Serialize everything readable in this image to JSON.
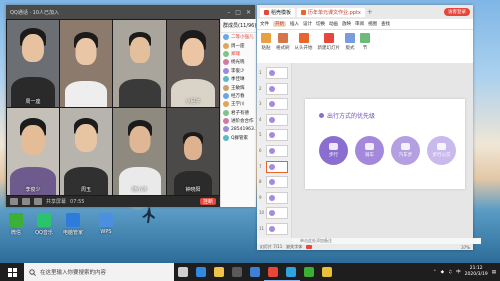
{
  "colors": {
    "accent_red": "#e8463a",
    "wps_orange": "#e8652b",
    "slide_purple": "#6a4fb0",
    "circle_colors": [
      "#8a6fd0",
      "#a388dc",
      "#b49fe3",
      "#c9b9ec"
    ]
  },
  "desktop": {
    "icons": [
      {
        "label": "WPS",
        "icon": "wps-doc-icon"
      },
      {
        "label": "QQ音乐",
        "icon": "music-icon"
      },
      {
        "label": "电脑管家",
        "icon": "shield-icon"
      },
      {
        "label": "微信",
        "icon": "wechat-icon"
      }
    ]
  },
  "qq": {
    "title": "QQ通话 · 10人已加入",
    "participants": [
      "周一座",
      "",
      "",
      "小尼子",
      "李俊少",
      "周玉",
      "随小沐",
      "钟晓阳"
    ],
    "controls": {
      "screen": "共享屏幕",
      "time": "07:55",
      "hangup": "挂断"
    },
    "member_header": "群成员(11/96)",
    "members": [
      {
        "name": "二等小强儿",
        "red": true
      },
      {
        "name": "周一座",
        "red": false
      },
      {
        "name": "郑瑞",
        "red": true
      },
      {
        "name": "杨光晓",
        "red": false
      },
      {
        "name": "李俊少",
        "red": false
      },
      {
        "name": "季佳琳",
        "red": false
      },
      {
        "name": "王敏辉",
        "red": false
      },
      {
        "name": "经万春",
        "red": false
      },
      {
        "name": "王学川",
        "red": false
      },
      {
        "name": "君子有德",
        "red": false
      },
      {
        "name": "进阶会合作",
        "red": false
      },
      {
        "name": "28541963...",
        "red": false
      },
      {
        "name": "Q群管家",
        "red": false
      }
    ]
  },
  "wps": {
    "tabs": [
      {
        "label": "稻壳模板"
      },
      {
        "label": "历年单元课文作业.pptx"
      }
    ],
    "login": "访客登录",
    "menu": [
      "文件",
      "开始",
      "插入",
      "设计",
      "切换",
      "动画",
      "放映",
      "审阅",
      "视图",
      "查找"
    ],
    "menu_selected": 1,
    "ribbon": [
      "粘贴",
      "格式刷",
      "从头开始",
      "新建幻灯片",
      "版式",
      "节"
    ],
    "slide_count": 11,
    "selected_slide": 7,
    "slide": {
      "title": "出行方式的优先级",
      "steps": [
        "步行",
        "骑车",
        "汽车步",
        "步行公交"
      ]
    },
    "note_hint": "单击此处添加备注",
    "status": {
      "slide": "幻灯片 7/11",
      "font": "缺失字体",
      "zoom": "37%"
    }
  },
  "taskbar": {
    "search_placeholder": "在这里输入你要搜索的内容",
    "apps": [
      "task-view-icon",
      "edge-icon",
      "file-explorer-icon",
      "store-icon",
      "mail-icon",
      "wps-icon",
      "qq-icon",
      "wechat-icon",
      "chrome-icon"
    ],
    "time": "21:12",
    "date": "2020/3/19",
    "ime": "中"
  }
}
